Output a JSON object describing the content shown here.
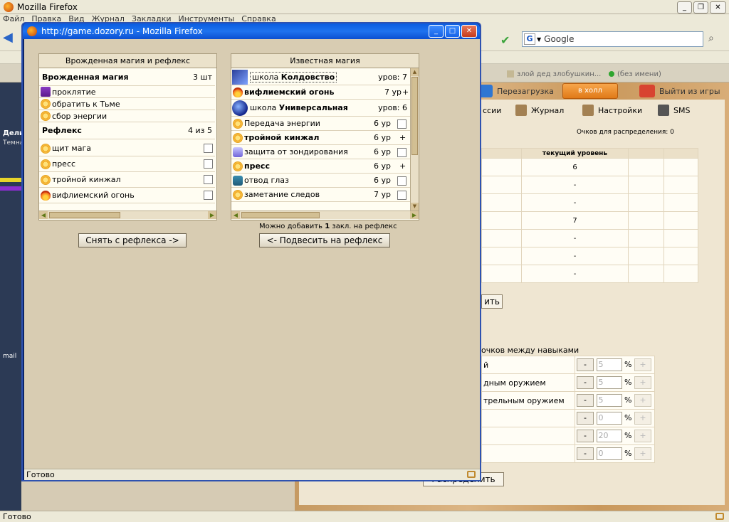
{
  "browser": {
    "title": "Mozilla Firefox",
    "menu": [
      "Файл",
      "Правка",
      "Вид",
      "Журнал",
      "Закладки",
      "Инструменты",
      "Справка"
    ],
    "search_placeholder": "Google",
    "status": "Готово"
  },
  "tabs": [
    "злой дед злобушкин...",
    "(без имени)"
  ],
  "game": {
    "top_buttons": {
      "reload": "Перезагрузка",
      "hall": "в холл",
      "exit": "Выйти из игры"
    },
    "nav": {
      "missions": "ссии",
      "journal": "Журнал",
      "settings": "Настройки",
      "sms": "SMS"
    },
    "left_labels": {
      "name": "Дели",
      "sub": "Темна",
      "mail": "mail"
    },
    "points_label": "Очков для распределения: 0",
    "table_header": "текущий уровень",
    "levels": [
      "6",
      "-",
      "-",
      "7",
      "-",
      "-",
      "-"
    ],
    "apply_btn": "ить",
    "distr_label": "очков между навыками",
    "skills": [
      {
        "label": "й",
        "value": "5"
      },
      {
        "label": "дным оружием",
        "value": "5"
      },
      {
        "label": "трельным оружием",
        "value": "5"
      },
      {
        "label": "",
        "value": "0"
      },
      {
        "label": "",
        "value": "20"
      },
      {
        "label": "",
        "value": "0"
      }
    ],
    "percent": "%",
    "minus": "-",
    "plus": "+",
    "distribute_btn": "Распределить"
  },
  "popup": {
    "title": "http://game.dozory.ru - Mozilla Firefox",
    "status": "Готово",
    "left_header": "Врожденная магия и рефлекс",
    "right_header": "Известная магия",
    "innate_title": "Врожденная магия",
    "innate_count": "3 шт",
    "innate": [
      {
        "name": "проклятие",
        "icon": "tornado-icon"
      },
      {
        "name": "обратить к Тьме",
        "icon": "sun-icon"
      },
      {
        "name": "сбор энергии",
        "icon": "sun-icon"
      }
    ],
    "reflex_title": "Рефлекс",
    "reflex_count": "4 из 5",
    "reflex": [
      {
        "name": "щит мага",
        "icon": "sun-icon"
      },
      {
        "name": "пресс",
        "icon": "sun-icon"
      },
      {
        "name": "тройной кинжал",
        "icon": "sun-icon"
      },
      {
        "name": "вифлиемский огонь",
        "icon": "fire-icon"
      }
    ],
    "school1_prefix": "школа",
    "school1_name": "Колдовство",
    "school1_level": "уров: 7",
    "fire_name": "вифлиемский огонь",
    "fire_level": "7 ур",
    "fire_plus": "+",
    "school2_prefix": "школа",
    "school2_name": "Универсальная",
    "school2_level": "уров: 6",
    "known": [
      {
        "name": "Передача энергии",
        "level": "6 ур",
        "mark": "checkbox",
        "bold": false,
        "icon": "sun-icon"
      },
      {
        "name": "тройной кинжал",
        "level": "6 ур",
        "mark": "+",
        "bold": true,
        "icon": "sun-icon"
      },
      {
        "name": "защита от зондирования",
        "level": "6 ур",
        "mark": "checkbox",
        "bold": false,
        "icon": "shield-icon"
      },
      {
        "name": "пресс",
        "level": "6 ур",
        "mark": "+",
        "bold": true,
        "icon": "sun-icon"
      },
      {
        "name": "отвод глаз",
        "level": "6 ур",
        "mark": "checkbox",
        "bold": false,
        "icon": "m-icon"
      },
      {
        "name": "заметание следов",
        "level": "7 ур",
        "mark": "checkbox",
        "bold": false,
        "icon": "sun-icon"
      }
    ],
    "add_note_pre": "Можно добавить",
    "add_note_num": "1",
    "add_note_post": "закл. на рефлекс",
    "remove_btn": "Снять с рефлекса ->",
    "attach_btn": "<- Подвесить на рефлекс"
  }
}
